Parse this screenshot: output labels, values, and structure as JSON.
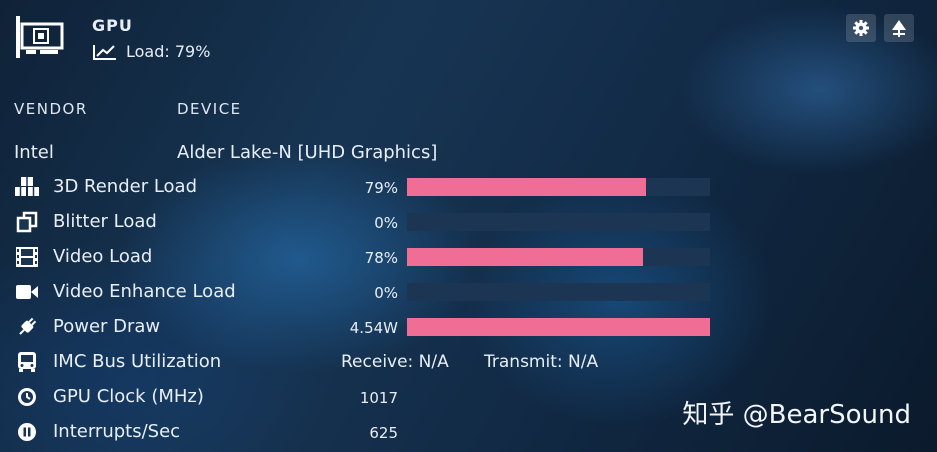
{
  "header": {
    "title": "GPU",
    "load_text": "Load: 79%",
    "settings_icon": "gear-icon",
    "pin_icon": "pin-icon"
  },
  "table_headers": {
    "vendor": "VENDOR",
    "device": "DEVICE"
  },
  "vendor": "Intel",
  "device": "Alder Lake-N [UHD Graphics]",
  "rows": [
    {
      "label": "3D Render Load",
      "icon": "cubes-icon",
      "value": "79%",
      "fraction": 0.79
    },
    {
      "label": "Blitter Load",
      "icon": "copy-icon",
      "value": "0%",
      "fraction": 0.0
    },
    {
      "label": "Video Load",
      "icon": "film-icon",
      "value": "78%",
      "fraction": 0.78
    },
    {
      "label": "Video Enhance Load",
      "icon": "video-camera-icon",
      "value": "0%",
      "fraction": 0.0
    },
    {
      "label": "Power Draw",
      "icon": "plug-icon",
      "value": "4.54W",
      "fraction": 1.0
    }
  ],
  "imc": {
    "label": "IMC Bus Utilization",
    "icon": "bus-icon",
    "receive": "Receive: N/A",
    "transmit": "Transmit: N/A"
  },
  "gpu_clock": {
    "label": "GPU Clock (MHz)",
    "icon": "clock-icon",
    "value": "1017"
  },
  "interrupts": {
    "label": "Interrupts/Sec",
    "icon": "interrupt-icon",
    "value": "625"
  },
  "watermark": "知乎 @BearSound",
  "colors": {
    "bar_fill": "#f06d96",
    "bar_track": "#1c3552"
  }
}
